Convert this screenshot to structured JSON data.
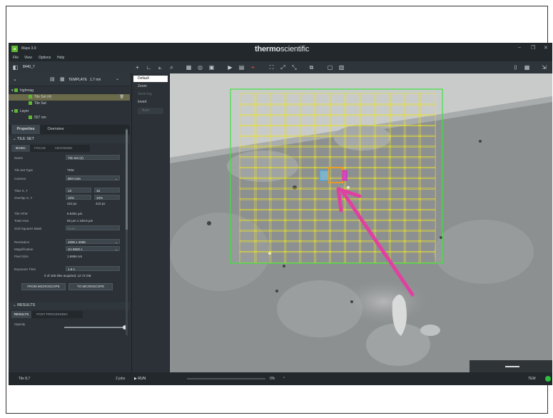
{
  "app": {
    "title": "Maps 3.9",
    "logo_text": "M",
    "brand_bold": "thermo",
    "brand_light": "scientific"
  },
  "menu": [
    "File",
    "View",
    "Options",
    "Help"
  ],
  "toolbar": {
    "project_name": "8440_7",
    "template_label": "TEMPLATE",
    "template_value": "1.7 nm"
  },
  "tree": [
    {
      "label": "highmag",
      "selected": false
    },
    {
      "label": "Tile Set (4)",
      "selected": true
    },
    {
      "label": "Tile Set",
      "selected": false
    },
    {
      "label": "Layer",
      "selected": false
    },
    {
      "label": "557 nm",
      "selected": false
    }
  ],
  "panel_tabs": {
    "properties": "Properties",
    "overview": "Overview"
  },
  "tile_set": {
    "section_title": "TILE SET",
    "subtabs": [
      "BASIC",
      "FOCUS",
      "ADVANCED"
    ],
    "name_label": "Name",
    "name_value": "Tile Set (4)",
    "type_label": "Tile Set Type",
    "type_value": "TEM",
    "camera_label": "Camera",
    "camera_value": "BM-Ceta",
    "tiles_label": "Tiles X, Y",
    "tiles_x": "13",
    "tiles_y": "16",
    "overlap_label": "Overlap X, Y",
    "overlap_x": "10%",
    "overlap_y": "10%",
    "px_x": "410 px",
    "px_y": "410 px",
    "hfw_label": "Tile HFW",
    "hfw_value": "6.9451 µm",
    "area_label": "Total Area",
    "area_value": "82 µm x 100.8 µm",
    "grid_label": "Grid Squares Mask",
    "grid_value": "None",
    "resolution_label": "Resolution",
    "resolution_value": "4096 x 4096",
    "magnification_label": "Magnification",
    "magnification_value": "SA 8500 x",
    "pixel_label": "Pixel Size",
    "pixel_value": "1.6956 nm",
    "exposure_label": "Exposure Time",
    "exposure_value": "1.6 s",
    "acquired_text": "0 of 165 tiles acquired, 12.72 GB",
    "btn_from": "FROM MICROSCOPE",
    "btn_to": "TO MICROSCOPE"
  },
  "results": {
    "section_title": "RESULTS",
    "subtabs": [
      "RESULTS",
      "POST PROCESSING"
    ],
    "opacity_label": "Opacity",
    "opacity_value": 1.0
  },
  "layers": [
    {
      "label": "Default",
      "state": "active"
    },
    {
      "label": "Zoom",
      "state": "normal"
    },
    {
      "label": "Semi-log",
      "state": "off"
    },
    {
      "label": "Invert",
      "state": "normal"
    },
    {
      "label": "Auto",
      "state": "off"
    }
  ],
  "status": {
    "tile": "Tile 8,7",
    "jobs": "2 jobs",
    "run": "RUN",
    "percent": "0%",
    "mode": "TEM"
  },
  "colors": {
    "accent": "#5fb832",
    "grid": "#e8e02a",
    "outer": "#3ee33e",
    "arrow": "#e040a0",
    "selected_tile": "#f29a1e"
  }
}
